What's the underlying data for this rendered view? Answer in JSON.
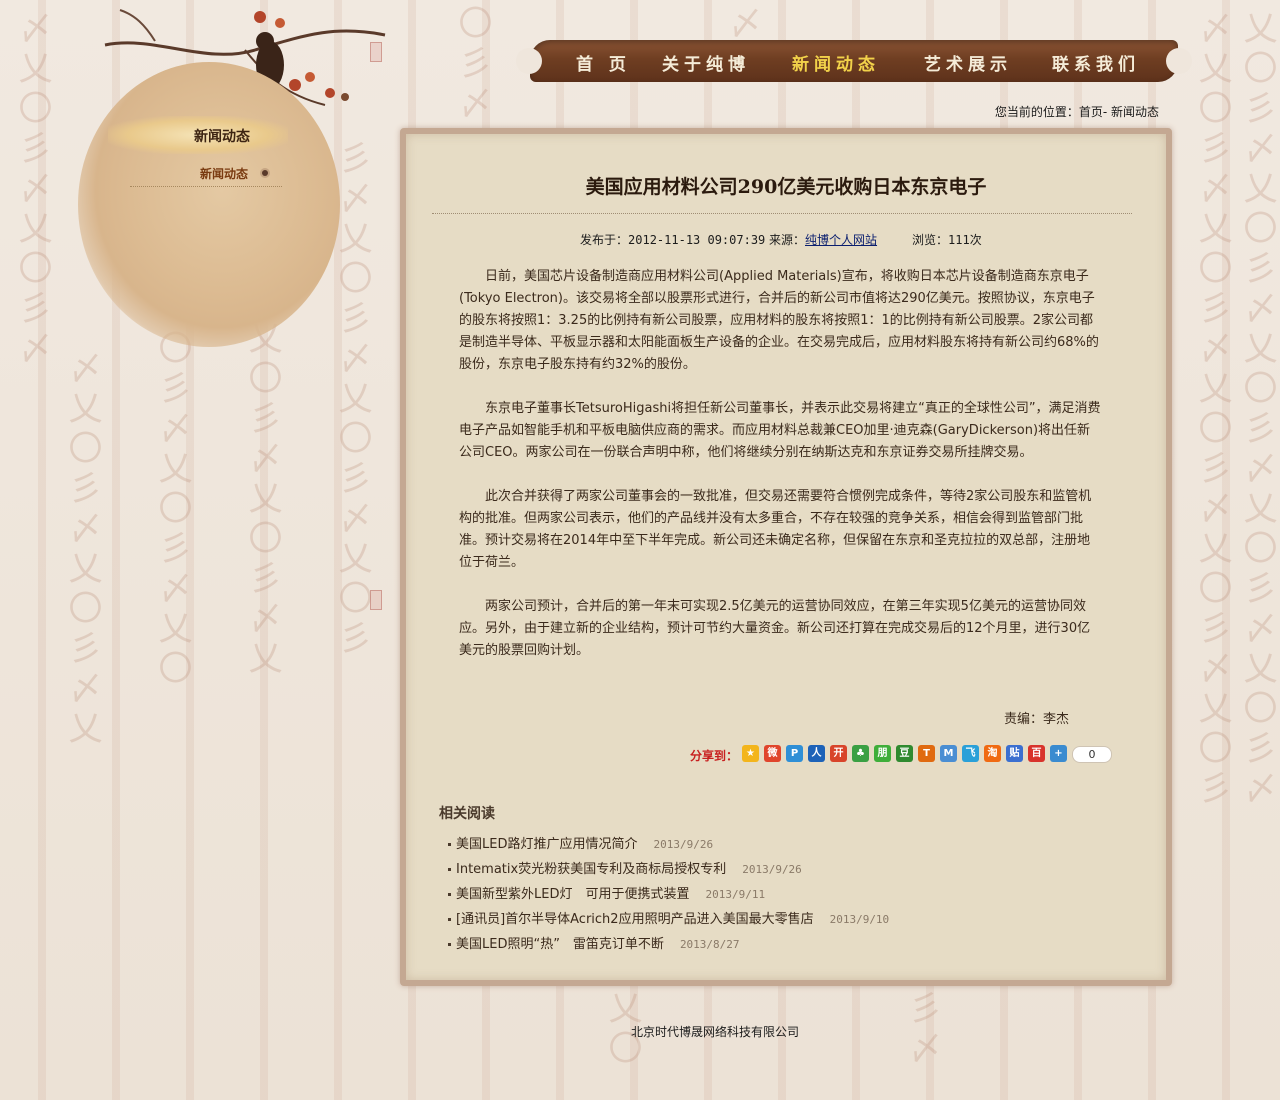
{
  "nav": {
    "items": [
      {
        "label": "首 页",
        "active": false
      },
      {
        "label": "关于纯博",
        "active": false
      },
      {
        "label": "新闻动态",
        "active": true
      },
      {
        "label": "艺术展示",
        "active": false
      },
      {
        "label": "联系我们",
        "active": false
      }
    ]
  },
  "sidebar": {
    "title": "新闻动态",
    "items": [
      {
        "label": "新闻动态"
      }
    ]
  },
  "breadcrumb": "您当前的位置：首页- 新闻动态",
  "article": {
    "title": "美国应用材料公司290亿美元收购日本东京电子",
    "meta": {
      "published_label": "发布于：",
      "published": "2012-11-13 09:07:39",
      "source_label": "来源：",
      "source": "纯博个人网站",
      "views_label": "浏览：",
      "views": "111次"
    },
    "paragraphs": [
      "日前，美国芯片设备制造商应用材料公司(Applied Materials)宣布，将收购日本芯片设备制造商东京电子(Tokyo Electron)。该交易将全部以股票形式进行，合并后的新公司市值将达290亿美元。按照协议，东京电子的股东将按照1：3.25的比例持有新公司股票，应用材料的股东将按照1：1的比例持有新公司股票。2家公司都是制造半导体、平板显示器和太阳能面板生产设备的企业。在交易完成后，应用材料股东将持有新公司约68%的股份，东京电子股东持有约32%的股份。",
      "东京电子董事长TetsuroHigashi将担任新公司董事长，并表示此交易将建立“真正的全球性公司”，满足消费电子产品如智能手机和平板电脑供应商的需求。而应用材料总裁兼CEO加里·迪克森(GaryDickerson)将出任新公司CEO。两家公司在一份联合声明中称，他们将继续分别在纳斯达克和东京证券交易所挂牌交易。",
      "此次合并获得了两家公司董事会的一致批准，但交易还需要符合惯例完成条件，等待2家公司股东和监管机构的批准。但两家公司表示，他们的产品线并没有太多重合，不存在较强的竞争关系，相信会得到监管部门批准。预计交易将在2014年中至下半年完成。新公司还未确定名称，但保留在东京和圣克拉拉的双总部，注册地位于荷兰。",
      "两家公司预计，合并后的第一年末可实现2.5亿美元的运营协同效应，在第三年实现5亿美元的运营协同效应。另外，由于建立新的企业结构，预计可节约大量资金。新公司还打算在完成交易后的12个月里，进行30亿美元的股票回购计划。"
    ],
    "editor": "责编：李杰"
  },
  "share": {
    "label": "分享到：",
    "count": "0",
    "icons": [
      {
        "name": "qzone-icon",
        "glyph": "★",
        "color": "#f3b51c"
      },
      {
        "name": "weibo-icon",
        "glyph": "微",
        "color": "#e0452c"
      },
      {
        "name": "tencent-weibo-icon",
        "glyph": "P",
        "color": "#2f8fd6"
      },
      {
        "name": "renren-icon",
        "glyph": "人",
        "color": "#1d62b8"
      },
      {
        "name": "kaixin-icon",
        "glyph": "开",
        "color": "#d8442a"
      },
      {
        "name": "clover-icon",
        "glyph": "♣",
        "color": "#3aa043"
      },
      {
        "name": "pengyou-icon",
        "glyph": "朋",
        "color": "#3fae3a"
      },
      {
        "name": "douban-icon",
        "glyph": "豆",
        "color": "#2f8a2f"
      },
      {
        "name": "tianya-icon",
        "glyph": "T",
        "color": "#e06a10"
      },
      {
        "name": "msn-icon",
        "glyph": "M",
        "color": "#4a8ed3"
      },
      {
        "name": "feixin-icon",
        "glyph": "飞",
        "color": "#2aa0d8"
      },
      {
        "name": "taobao-icon",
        "glyph": "淘",
        "color": "#f06a12"
      },
      {
        "name": "tieba-icon",
        "glyph": "贴",
        "color": "#3b6fd0"
      },
      {
        "name": "baidu-icon",
        "glyph": "百",
        "color": "#d8332c"
      },
      {
        "name": "more-icon",
        "glyph": "+",
        "color": "#3a8bd0"
      }
    ]
  },
  "related": {
    "title": "相关阅读",
    "items": [
      {
        "title": "美国LED路灯推广应用情况简介",
        "date": "2013/9/26"
      },
      {
        "title": "Intematix荧光粉获美国专利及商标局授权专利",
        "date": "2013/9/26"
      },
      {
        "title": "美国新型紫外LED灯　可用于便携式装置",
        "date": "2013/9/11"
      },
      {
        "title": "[通讯员]首尔半导体Acrich2应用照明产品进入美国最大零售店",
        "date": "2013/9/10"
      },
      {
        "title": "美国LED照明“热”　雷笛克订单不断",
        "date": "2013/8/27"
      }
    ]
  },
  "footer": "北京时代博晟网络科技有限公司",
  "colors": {
    "accent": "#f2d24a",
    "nav_bg": "#6f3e22",
    "share_label": "#c82020"
  }
}
